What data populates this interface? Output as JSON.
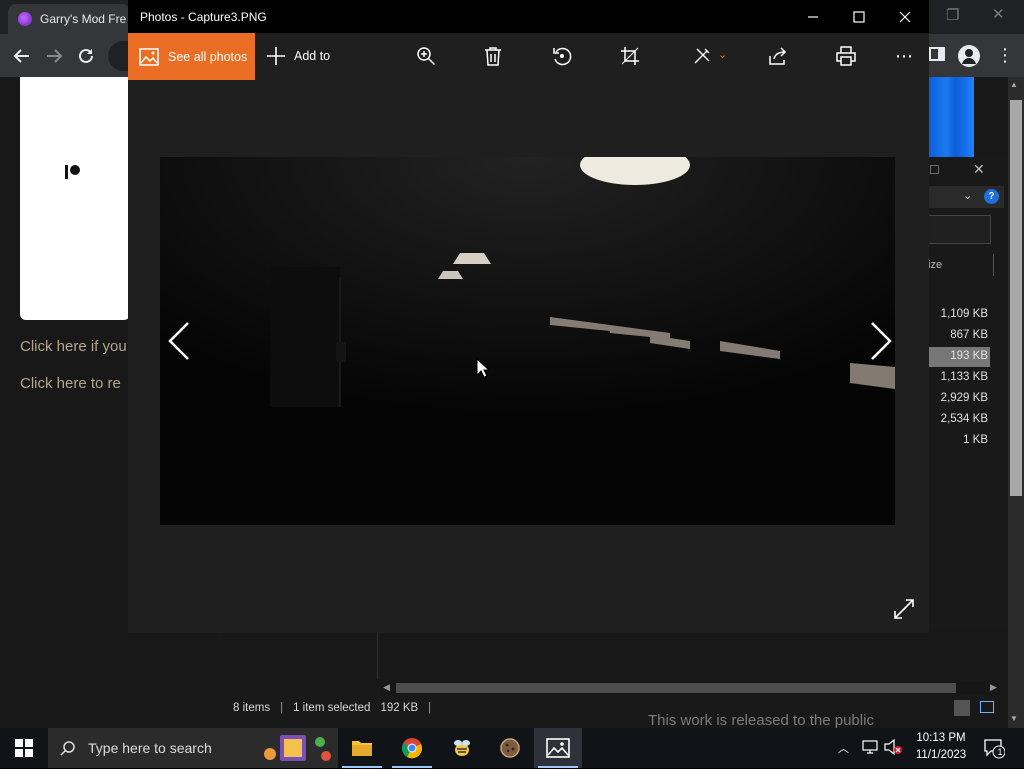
{
  "chrome": {
    "tab_title": "Garry's Mod Fre",
    "links": [
      "Click here if you",
      "Click here to re"
    ]
  },
  "photos": {
    "window_title": "Photos - Capture3.PNG",
    "see_all_label": "See all photos",
    "add_to_label": "Add to",
    "toolbar_icons": [
      "zoom-icon",
      "delete-icon",
      "rotate-icon",
      "crop-icon",
      "edit-icon",
      "share-icon",
      "print-icon",
      "more-icon"
    ],
    "accent_color": "#e96d22"
  },
  "explorer": {
    "sizes": [
      "1,109 KB",
      "867 KB",
      "193 KB",
      "1,133 KB",
      "2,929 KB",
      "2,534 KB",
      "1 KB"
    ],
    "selected_index": 2,
    "column_label": "ize",
    "status": {
      "items": "8 items",
      "selected": "1 item selected",
      "size": "192 KB"
    }
  },
  "background_text": "This work is released to the public",
  "taskbar": {
    "search_placeholder": "Type here to search",
    "time": "10:13 PM",
    "date": "11/1/2023",
    "notification_count": "1"
  }
}
